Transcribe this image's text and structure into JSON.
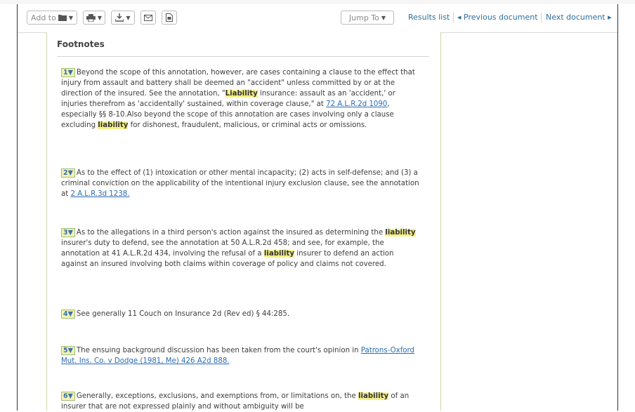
{
  "toolbar": {
    "add_to_label": "Add to",
    "jump_to_label": "Jump To",
    "results_list": "Results list",
    "previous_document": "Previous document",
    "next_document": "Next document"
  },
  "footnotes": {
    "heading": "Footnotes",
    "items": [
      {
        "num": "1",
        "parts": [
          {
            "t": "Beyond the scope of this annotation, however, are cases containing a clause to the effect that injury from assault and battery shall be deemed an \"accident\" unless committed by or at the direction of the insured. See the annotation, \""
          },
          {
            "t": "Liability",
            "hl": true
          },
          {
            "t": " insurance: assault as an 'accident,' or injuries therefrom as 'accidentally' sustained, within coverage clause,\" at "
          },
          {
            "t": "72 A.L.R.2d 1090",
            "link": true
          },
          {
            "t": ", especially §§ 8-10.Also beyond the scope of this annotation are cases involving only a clause excluding "
          },
          {
            "t": "liability",
            "hl": true
          },
          {
            "t": " for dishonest, fraudulent, malicious, or criminal acts or omissions."
          }
        ]
      },
      {
        "num": "2",
        "parts": [
          {
            "t": "As to the effect of (1) intoxication or other mental incapacity; (2) acts in self-defense; and (3) a criminal conviction on the applicability of the intentional injury exclusion clause, see the annotation at "
          },
          {
            "t": "2 A.L.R.3d 1238.",
            "link": true
          }
        ]
      },
      {
        "num": "3",
        "parts": [
          {
            "t": "As to the allegations in a third person's action against the insured as determining the "
          },
          {
            "t": "liability",
            "hl": true
          },
          {
            "t": " insurer's duty to defend, see the annotation at 50 A.L.R.2d 458; and see, for example, the annotation at 41 A.L.R.2d 434, involving the refusal of a "
          },
          {
            "t": "liability",
            "hl": true
          },
          {
            "t": " insurer to defend an action against an insured involving both claims within coverage of policy and claims not covered."
          }
        ]
      },
      {
        "num": "4",
        "parts": [
          {
            "t": "See generally 11 Couch on Insurance 2d (Rev ed) § 44:285."
          }
        ]
      },
      {
        "num": "5",
        "parts": [
          {
            "t": "The ensuing background discussion has been taken from the court's opinion in "
          },
          {
            "t": "Patrons-Oxford Mut. Ins. Co. v Dodge (1981, Me) 426 A2d 888.",
            "link": true
          }
        ]
      },
      {
        "num": "6",
        "parts": [
          {
            "t": "Generally, exceptions, exclusions, and exemptions from, or limitations on, the "
          },
          {
            "t": "liability",
            "hl": true
          },
          {
            "t": " of an insurer that are not expressed plainly and without ambiguity will be"
          }
        ]
      }
    ]
  }
}
